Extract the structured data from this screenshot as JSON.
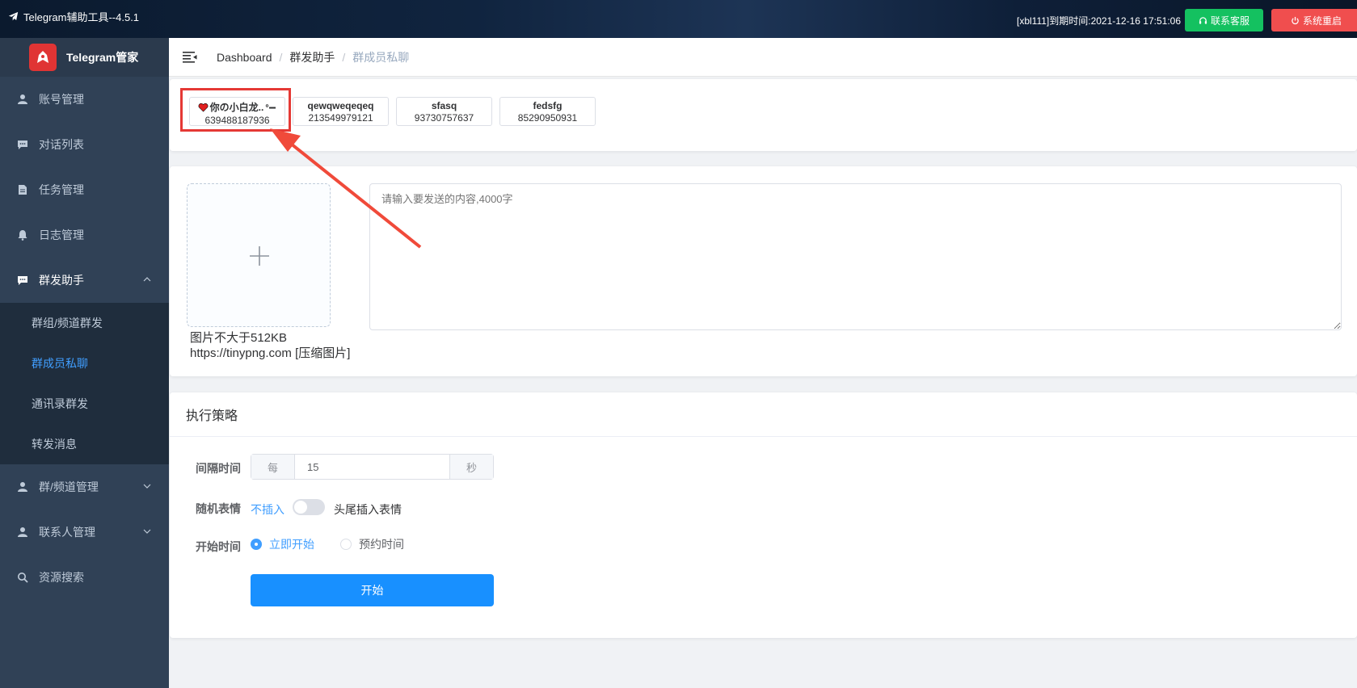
{
  "topbar": {
    "title": "Telegram辅助工具--4.5.1",
    "expiry": "[xbl111]到期时间:2021-12-16 17:51:06",
    "support_label": "联系客服",
    "restart_label": "系统重启",
    "colors": {
      "support": "#14c160",
      "restart": "#f04e4e"
    }
  },
  "sidebar": {
    "logo_text": "Telegram管家",
    "items": [
      {
        "label": "账号管理",
        "icon": "user-icon"
      },
      {
        "label": "对话列表",
        "icon": "chat-icon"
      },
      {
        "label": "任务管理",
        "icon": "document-icon"
      },
      {
        "label": "日志管理",
        "icon": "bell-icon"
      },
      {
        "label": "群发助手",
        "icon": "chat-icon",
        "expanded": true
      },
      {
        "label": "群/频道管理",
        "icon": "user-icon",
        "expanded": false
      },
      {
        "label": "联系人管理",
        "icon": "user-icon",
        "expanded": false
      },
      {
        "label": "资源搜索",
        "icon": "search-icon"
      }
    ],
    "submenu": [
      {
        "label": "群组/频道群发",
        "active": false
      },
      {
        "label": "群成员私聊",
        "active": true
      },
      {
        "label": "通讯录群发",
        "active": false
      },
      {
        "label": "转发消息",
        "active": false
      }
    ]
  },
  "breadcrumb": [
    "Dashboard",
    "群发助手",
    "群成员私聊"
  ],
  "accounts": [
    {
      "name": "你の小白龙..",
      "phone": "639488187936",
      "selected": true
    },
    {
      "name": "qewqweqeqeq",
      "phone": "213549979121",
      "selected": false
    },
    {
      "name": "sfasq",
      "phone": "93730757637",
      "selected": false
    },
    {
      "name": "fedsfg",
      "phone": "85290950931",
      "selected": false
    }
  ],
  "compose": {
    "upload_hint_line1": "图片不大于512KB",
    "upload_hint_line2": "https://tinypng.com [压缩图片]",
    "message_placeholder": "请输入要发送的内容,4000字"
  },
  "strategy": {
    "title": "执行策略",
    "interval_label": "间隔时间",
    "interval_prefix": "每",
    "interval_value": "15",
    "interval_suffix": "秒",
    "emoji_label": "随机表情",
    "emoji_off_text": "不插入",
    "emoji_on_text": "头尾插入表情",
    "emoji_enabled": false,
    "start_time_label": "开始时间",
    "start_now_label": "立即开始",
    "start_schedule_label": "预约时间",
    "start_button_label": "开始",
    "accent": "#1890ff"
  }
}
